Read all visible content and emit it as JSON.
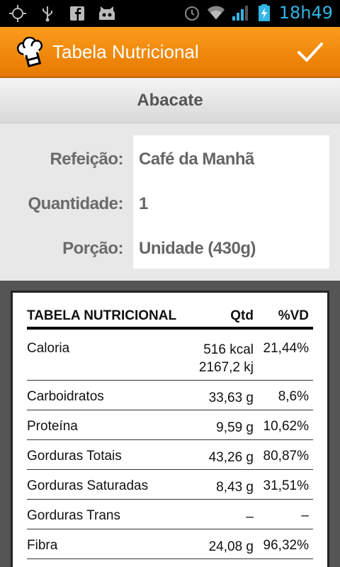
{
  "status_bar": {
    "time": "18h49",
    "icons": [
      "gps-icon",
      "usb-icon",
      "facebook-icon",
      "cyanogen-mod-icon",
      "alarm-icon",
      "wifi-icon",
      "signal-icon",
      "battery-charging-icon"
    ]
  },
  "action_bar": {
    "title": "Tabela Nutricional",
    "app_icon": "chef-hat-icon",
    "confirm_icon": "checkmark-icon"
  },
  "food": {
    "name": "Abacate"
  },
  "form": {
    "rows": [
      {
        "label": "Refeição:",
        "value": "Café da Manhã"
      },
      {
        "label": "Quantidade:",
        "value": "1"
      },
      {
        "label": "Porção:",
        "value": "Unidade (430g)"
      }
    ]
  },
  "nutrition_table": {
    "header": {
      "name": "TABELA NUTRICIONAL",
      "qtd": "Qtd",
      "vd": "%VD"
    },
    "rows": [
      {
        "name": "Caloria",
        "qtd": "516 kcal",
        "qtd2": "2167,2 kj",
        "vd": "21,44%"
      },
      {
        "name": "Carboidratos",
        "qtd": "33,63 g",
        "vd": "8,6%"
      },
      {
        "name": "Proteína",
        "qtd": "9,59 g",
        "vd": "10,62%"
      },
      {
        "name": "Gorduras Totais",
        "qtd": "43,26 g",
        "vd": "80,87%"
      },
      {
        "name": "Gorduras Saturadas",
        "qtd": "8,43 g",
        "vd": "31,51%"
      },
      {
        "name": "Gorduras Trans",
        "qtd": "–",
        "vd": "–"
      },
      {
        "name": "Fibra",
        "qtd": "24,08 g",
        "vd": "96,32%"
      }
    ]
  },
  "colors": {
    "action_bar": "#f08a0c",
    "status_text": "#33b5e5"
  }
}
